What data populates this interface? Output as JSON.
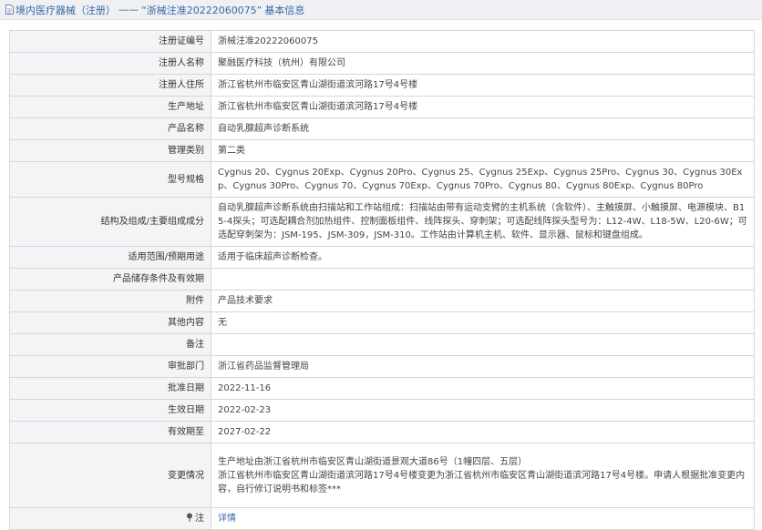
{
  "header": {
    "category": "境内医疗器械（注册）",
    "separator": "——",
    "reg_no_quoted": "“浙械注准20222060075”",
    "section": "基本信息"
  },
  "rows": [
    {
      "label": "注册证编号",
      "value": "浙械注准20222060075"
    },
    {
      "label": "注册人名称",
      "value": "聚融医疗科技（杭州）有限公司"
    },
    {
      "label": "注册人住所",
      "value": "浙江省杭州市临安区青山湖街道滨河路17号4号楼"
    },
    {
      "label": "生产地址",
      "value": "浙江省杭州市临安区青山湖街道滨河路17号4号楼"
    },
    {
      "label": "产品名称",
      "value": "自动乳腺超声诊断系统"
    },
    {
      "label": "管理类别",
      "value": "第二类"
    },
    {
      "label": "型号规格",
      "value": "Cygnus 20、Cygnus 20Exp、Cygnus 20Pro、Cygnus 25、Cygnus 25Exp、Cygnus 25Pro、Cygnus 30、Cygnus 30Exp、Cygnus 30Pro、Cygnus 70、Cygnus 70Exp、Cygnus 70Pro、Cygnus 80、Cygnus 80Exp、Cygnus 80Pro"
    },
    {
      "label": "结构及组成/主要组成成分",
      "value": "自动乳腺超声诊断系统由扫描站和工作站组成：扫描站由带有运动支臂的主机系统（含软件）、主触摸屏、小触摸屏、电源模块、B15-4探头；可选配耦合剂加热组件、控制面板组件、线阵探头、穿刺架；可选配线阵探头型号为：L12-4W、L18-5W、L20-6W；可选配穿刺架为：JSM-195、JSM-309，JSM-310。工作站由计算机主机、软件、显示器、鼠标和键盘组成。"
    },
    {
      "label": "适用范围/预期用途",
      "value": "适用于临床超声诊断检查。"
    },
    {
      "label": "产品储存条件及有效期",
      "value": ""
    },
    {
      "label": "附件",
      "value": "产品技术要求"
    },
    {
      "label": "其他内容",
      "value": "无"
    },
    {
      "label": "备注",
      "value": ""
    },
    {
      "label": "审批部门",
      "value": "浙江省药品监督管理局"
    },
    {
      "label": "批准日期",
      "value": "2022-11-16"
    },
    {
      "label": "生效日期",
      "value": "2022-02-23"
    },
    {
      "label": "有效期至",
      "value": "2027-02-22"
    },
    {
      "label": "变更情况",
      "value_lines": [
        "生产地址由浙江省杭州市临安区青山湖街道景观大道86号（1幢四层、五层）",
        "浙江省杭州市临安区青山湖街道滨河路17号4号楼变更为浙江省杭州市临安区青山湖街道滨河路17号4号楼。申请人根据批准变更内容，自行修订说明书和标签***"
      ]
    },
    {
      "label": "注",
      "value": "详情",
      "icon": "pin-icon"
    }
  ],
  "colors": {
    "header_bg": "#eef0f3",
    "accent": "#3b66a5",
    "label_bg": "#f3f4f6",
    "border": "#d3d6db"
  }
}
